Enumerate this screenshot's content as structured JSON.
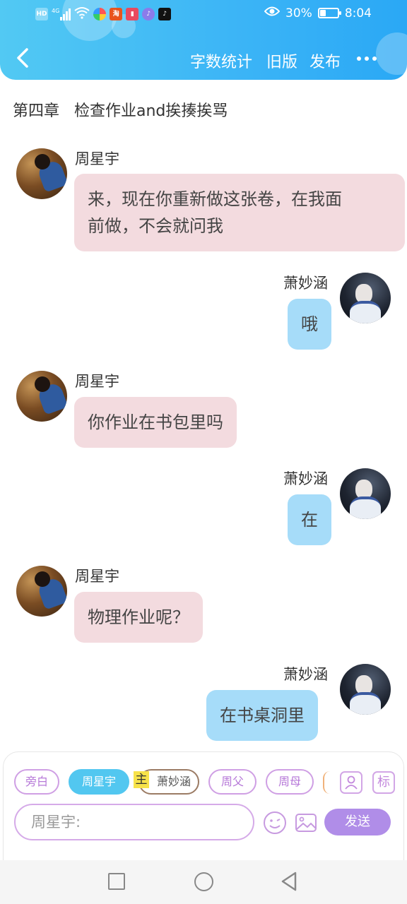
{
  "status_bar": {
    "signal_label": "4G",
    "battery_percent": "30%",
    "battery_level": 0.3,
    "time": "8:04"
  },
  "header": {
    "nav_items": [
      "字数统计",
      "旧版",
      "发布"
    ],
    "accent_color": "#3bb4f6"
  },
  "chapter_title": "第四章   检查作业and挨揍挨骂",
  "messages": [
    {
      "side": "left",
      "sender": "周星宇",
      "lines": [
        "来，现在你重新做这张卷，在我面",
        "前做，不会就问我"
      ]
    },
    {
      "side": "right",
      "sender": "萧妙涵",
      "lines": [
        "哦"
      ]
    },
    {
      "side": "left",
      "sender": "周星宇",
      "lines": [
        "你作业在书包里吗"
      ]
    },
    {
      "side": "right",
      "sender": "萧妙涵",
      "lines": [
        "在"
      ]
    },
    {
      "side": "left",
      "sender": "周星宇",
      "lines": [
        "物理作业呢？"
      ]
    },
    {
      "side": "right",
      "sender": "萧妙涵",
      "lines": [
        "在书桌洞里"
      ]
    }
  ],
  "roles": {
    "chips": [
      "旁白",
      "周星宇",
      "萧妙涵",
      "周父",
      "周母"
    ],
    "active_chip": "周星宇",
    "main_badge": "主",
    "tag_icon_label": "标"
  },
  "input": {
    "placeholder": "周星宇:",
    "send_label": "发送"
  }
}
